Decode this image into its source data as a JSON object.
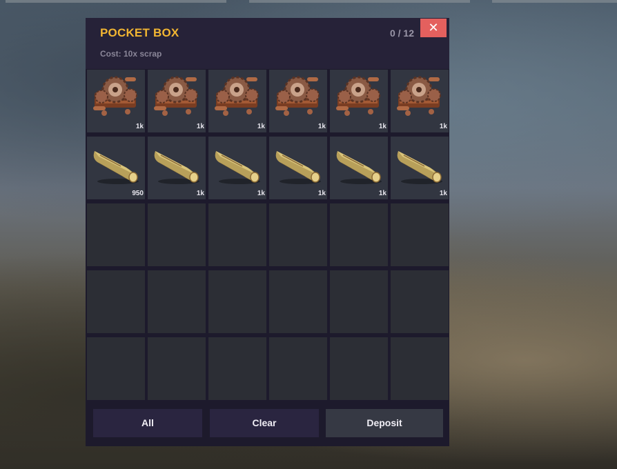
{
  "panel": {
    "title": "POCKET BOX",
    "cost": "Cost: 10x scrap",
    "counter": "0 / 12",
    "close_symbol": "✕"
  },
  "colors": {
    "title": "#f2b632",
    "close_button": "#e4605e",
    "panel_bg": "#1d1a2c"
  },
  "grid": {
    "columns": 6,
    "rows": 5,
    "slots": [
      {
        "item": "gears",
        "icon": "gears-icon",
        "qty": "1k"
      },
      {
        "item": "gears",
        "icon": "gears-icon",
        "qty": "1k"
      },
      {
        "item": "gears",
        "icon": "gears-icon",
        "qty": "1k"
      },
      {
        "item": "gears",
        "icon": "gears-icon",
        "qty": "1k"
      },
      {
        "item": "gears",
        "icon": "gears-icon",
        "qty": "1k"
      },
      {
        "item": "gears",
        "icon": "gears-icon",
        "qty": "1k"
      },
      {
        "item": "wood",
        "icon": "wood-log-icon",
        "qty": "950"
      },
      {
        "item": "wood",
        "icon": "wood-log-icon",
        "qty": "1k"
      },
      {
        "item": "wood",
        "icon": "wood-log-icon",
        "qty": "1k"
      },
      {
        "item": "wood",
        "icon": "wood-log-icon",
        "qty": "1k"
      },
      {
        "item": "wood",
        "icon": "wood-log-icon",
        "qty": "1k"
      },
      {
        "item": "wood",
        "icon": "wood-log-icon",
        "qty": "1k"
      },
      null,
      null,
      null,
      null,
      null,
      null,
      null,
      null,
      null,
      null,
      null,
      null,
      null,
      null,
      null,
      null,
      null,
      null
    ]
  },
  "footer": {
    "all_label": "All",
    "clear_label": "Clear",
    "deposit_label": "Deposit"
  }
}
